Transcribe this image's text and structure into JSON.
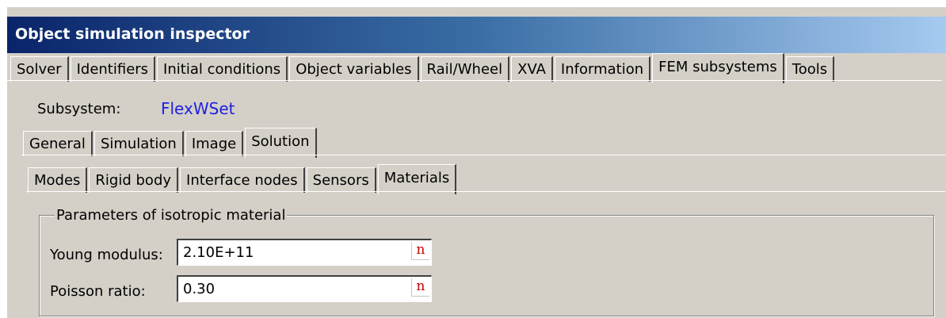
{
  "window": {
    "title": "Object simulation inspector"
  },
  "main_tabs": [
    "Solver",
    "Identifiers",
    "Initial conditions",
    "Object variables",
    "Rail/Wheel",
    "XVA",
    "Information",
    "FEM subsystems",
    "Tools"
  ],
  "main_active": "FEM subsystems",
  "subsystem": {
    "label": "Subsystem:",
    "value": "FlexWSet"
  },
  "sub_tabs": [
    "General",
    "Simulation",
    "Image",
    "Solution"
  ],
  "sub_active": "Solution",
  "solution_tabs": [
    "Modes",
    "Rigid body",
    "Interface nodes",
    "Sensors",
    "Materials"
  ],
  "solution_active": "Materials",
  "group": {
    "title": "Parameters of isotropic material",
    "young_label": "Young modulus:",
    "young_value": "2.10E+11",
    "poisson_label": "Poisson ratio:",
    "poisson_value": "0.30",
    "unit_icon": "n"
  },
  "colors": {
    "title_start": "#0a246a",
    "title_end": "#a6caf0",
    "subsystem_value": "#2020e0",
    "unit_icon": "#c00000",
    "face": "#d4d0c8"
  }
}
